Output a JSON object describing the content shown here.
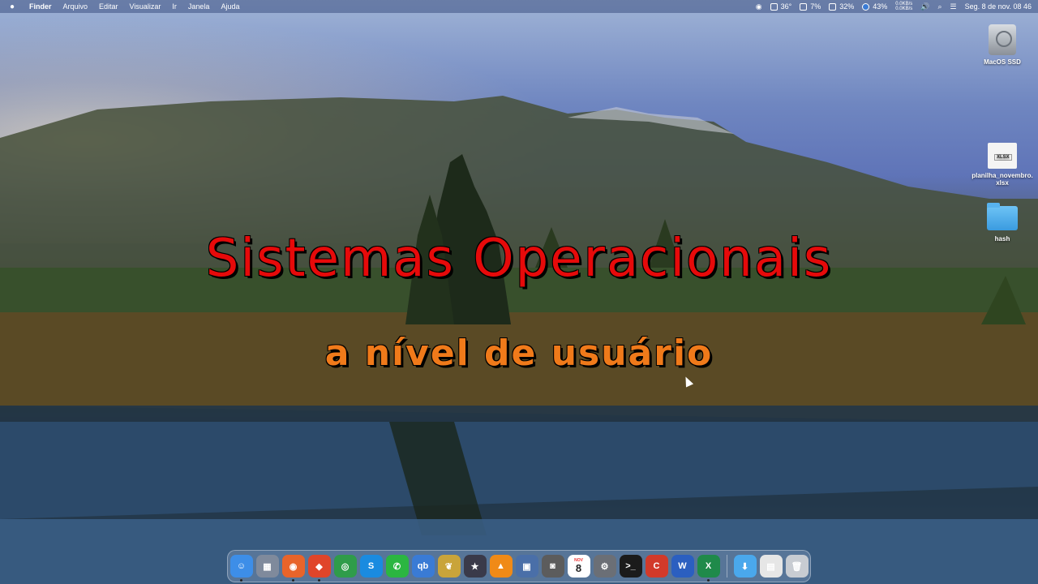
{
  "menubar": {
    "apple": "",
    "app_name": "Finder",
    "items": [
      "Arquivo",
      "Editar",
      "Visualizar",
      "Ir",
      "Janela",
      "Ajuda"
    ],
    "status": {
      "temperature": "36°",
      "cpu": "7%",
      "memory": "32%",
      "battery": "43%",
      "net_up": "0.0KB/s",
      "net_down": "0.0KB/s",
      "datetime": "Seg. 8 de nov.  08 46"
    }
  },
  "desktop_icons": [
    {
      "label": "MacOS SSD",
      "kind": "drive-icon"
    },
    {
      "label": "planilha_novembro.xlsx",
      "kind": "xlsx-file-icon",
      "badge": "XLSX"
    },
    {
      "label": "hash",
      "kind": "folder-icon"
    }
  ],
  "overlay": {
    "title": "Sistemas Operacionais",
    "subtitle": "a nível de usuário"
  },
  "dock": {
    "apps": [
      {
        "name": "finder-icon",
        "color": "#3d8ee8",
        "glyph": "☺",
        "running": true
      },
      {
        "name": "launchpad-icon",
        "color": "#7f8a9c",
        "glyph": "▦",
        "running": false
      },
      {
        "name": "firefox-icon",
        "color": "#e8642a",
        "glyph": "◉",
        "running": true
      },
      {
        "name": "brave-icon",
        "color": "#e0452a",
        "glyph": "◆",
        "running": true
      },
      {
        "name": "chrome-icon",
        "color": "#2f9c4a",
        "glyph": "◎",
        "running": false
      },
      {
        "name": "shazam-icon",
        "color": "#1a8be0",
        "glyph": "S",
        "running": false
      },
      {
        "name": "whatsapp-icon",
        "color": "#2bb641",
        "glyph": "✆",
        "running": false
      },
      {
        "name": "qbittorrent-icon",
        "color": "#3a7bd5",
        "glyph": "qb",
        "running": false
      },
      {
        "name": "cocktail-icon",
        "color": "#c9a43a",
        "glyph": "❦",
        "running": false
      },
      {
        "name": "final-cut-icon",
        "color": "#3a3a4a",
        "glyph": "★",
        "running": false
      },
      {
        "name": "vlc-icon",
        "color": "#f08a17",
        "glyph": "▲",
        "running": false
      },
      {
        "name": "virtualbox-icon",
        "color": "#4a6fa8",
        "glyph": "▣",
        "running": false
      },
      {
        "name": "screenshot-icon",
        "color": "#5c5c5c",
        "glyph": "◙",
        "running": false
      },
      {
        "name": "calendar-icon",
        "color": "#ffffff",
        "glyph": "8",
        "month": "NOV",
        "running": false
      },
      {
        "name": "system-preferences-icon",
        "color": "#6b6f76",
        "glyph": "⚙",
        "running": false
      },
      {
        "name": "terminal-icon",
        "color": "#1b1b1b",
        "glyph": ">_",
        "running": false
      },
      {
        "name": "ccleaner-icon",
        "color": "#d23a2a",
        "glyph": "C",
        "running": false
      },
      {
        "name": "word-icon",
        "color": "#2b5fc0",
        "glyph": "W",
        "running": false
      },
      {
        "name": "excel-icon",
        "color": "#1f8a4a",
        "glyph": "X",
        "running": true
      }
    ],
    "extras": [
      {
        "name": "downloads-folder-icon",
        "color": "#4aa8ec",
        "glyph": "⬇"
      },
      {
        "name": "document-stack-icon",
        "color": "#e6e6e6",
        "glyph": "▤"
      },
      {
        "name": "trash-icon",
        "color": "#c8ccd2",
        "glyph": "🗑"
      }
    ]
  }
}
